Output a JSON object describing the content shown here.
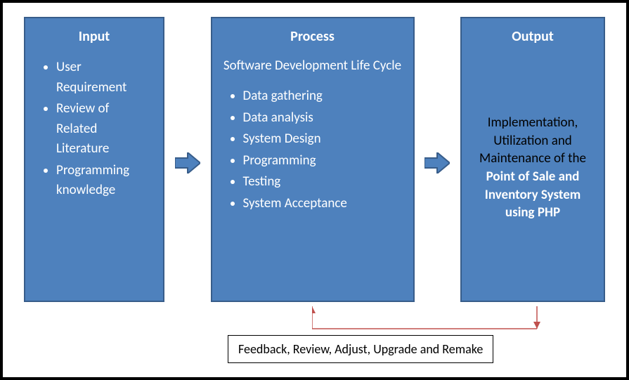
{
  "input": {
    "title": "Input",
    "items": [
      "User Requirement",
      "Review of Related Literature",
      "Programming knowledge"
    ]
  },
  "process": {
    "title": "Process",
    "subtitle": "Software Development Life Cycle",
    "items": [
      "Data gathering",
      "Data analysis",
      "System Design",
      "Programming",
      "Testing",
      "System Acceptance"
    ]
  },
  "output": {
    "title": "Output",
    "text_prefix": "Implementation, Utilization and Maintenance of the ",
    "text_bold": "Point of Sale and Inventory System using PHP"
  },
  "feedback": {
    "label": "Feedback, Review, Adjust, Upgrade and Remake"
  },
  "colors": {
    "box_fill": "#4e81bd",
    "box_border": "#385d8a",
    "arrow_fill": "#4e81bd",
    "arrow_border": "#385d8a",
    "feedback_line": "#c0504d"
  }
}
